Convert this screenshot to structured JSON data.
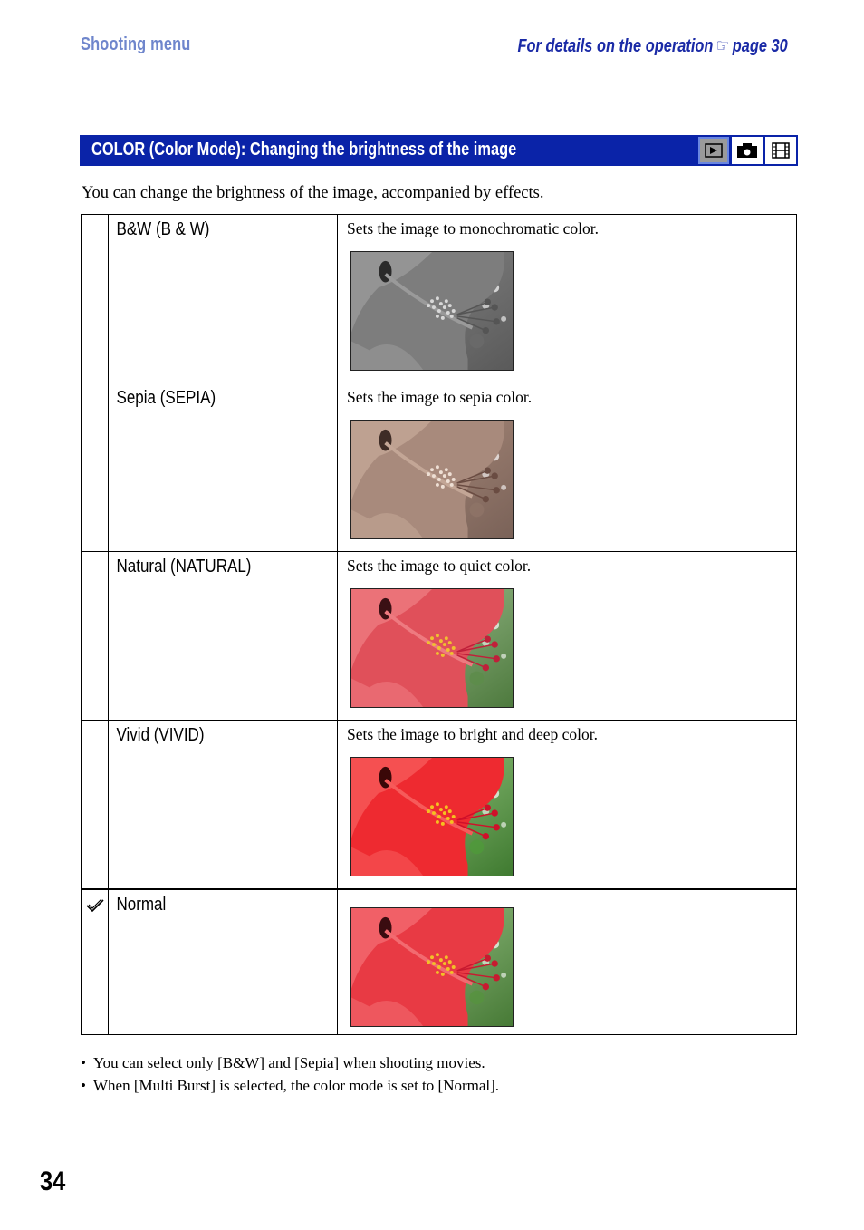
{
  "header": {
    "section": "Shooting menu",
    "reference_prefix": "For details on the operation",
    "reference_icon": "pointing-hand-icon",
    "reference_page": "page 30"
  },
  "title_bar": {
    "title": "COLOR (Color Mode): Changing the brightness of the image",
    "mode_icons": [
      {
        "name": "playback-icon",
        "active": true
      },
      {
        "name": "camera-icon",
        "active": false
      },
      {
        "name": "movie-icon",
        "active": false
      }
    ],
    "colors": {
      "bar": "#0a23a8",
      "active_icon_bg": "#9a9a9a"
    }
  },
  "intro": "You can change the brightness of the image, accompanied by effects.",
  "options": [
    {
      "name": "B&W (B & W)",
      "description": "Sets the image to monochromatic color.",
      "photo": "bw",
      "selected": false
    },
    {
      "name": "Sepia (SEPIA)",
      "description": "Sets the image to sepia color.",
      "photo": "sepia",
      "selected": false
    },
    {
      "name": "Natural (NATURAL)",
      "description": "Sets the image to quiet color.",
      "photo": "natural",
      "selected": false
    },
    {
      "name": "Vivid (VIVID)",
      "description": "Sets the image to bright and deep color.",
      "photo": "vivid",
      "selected": false
    },
    {
      "name": "Normal",
      "description": "",
      "photo": "normal",
      "selected": true
    }
  ],
  "notes": [
    "You can select only [B&W] and [Sepia] when shooting movies.",
    "When [Multi Burst] is selected, the color mode is set to [Normal]."
  ],
  "page_number": "34"
}
